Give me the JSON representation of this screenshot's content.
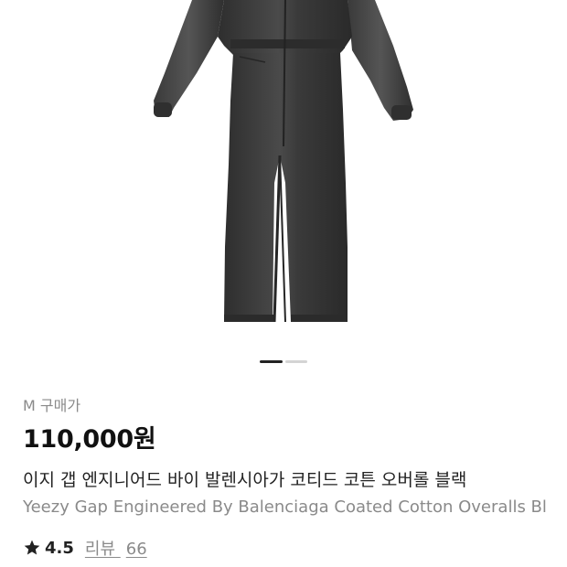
{
  "product": {
    "size_label": "M",
    "price_type": "구매가",
    "price": "110,000원",
    "title_ko": "이지 갭 엔지니어드 바이 발렌시아가 코티드 코튼 오버롤 블랙",
    "title_en": "Yeezy Gap Engineered By Balenciaga Coated Cotton Overalls Bl",
    "image_icon": "coverall-photo",
    "image_color": "#3f3f3f"
  },
  "carousel": {
    "slide_count": 2,
    "active_index": 1
  },
  "rating": {
    "icon": "star-icon",
    "value": "4.5",
    "reviews_label": "리뷰",
    "reviews_count": "66"
  }
}
